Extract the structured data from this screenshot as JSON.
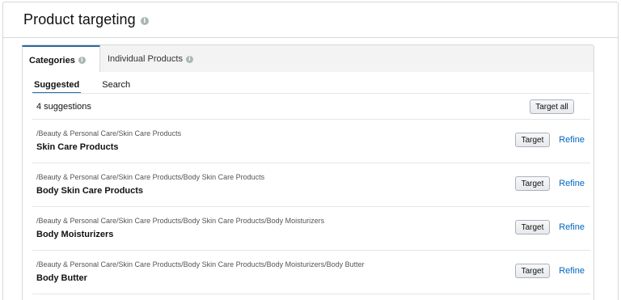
{
  "header": {
    "title": "Product targeting",
    "info_icon": "info-icon"
  },
  "tabs": [
    {
      "label": "Categories",
      "active": true
    },
    {
      "label": "Individual Products",
      "active": false
    }
  ],
  "subtabs": [
    {
      "label": "Suggested",
      "active": true
    },
    {
      "label": "Search",
      "active": false
    }
  ],
  "summary": {
    "count_label": "4 suggestions",
    "target_all_label": "Target all"
  },
  "suggestions": [
    {
      "path": "/Beauty & Personal Care/Skin Care Products",
      "name": "Skin Care Products",
      "target_label": "Target",
      "refine_label": "Refine"
    },
    {
      "path": "/Beauty & Personal Care/Skin Care Products/Body Skin Care Products",
      "name": "Body Skin Care Products",
      "target_label": "Target",
      "refine_label": "Refine"
    },
    {
      "path": "/Beauty & Personal Care/Skin Care Products/Body Skin Care Products/Body Moisturizers",
      "name": "Body Moisturizers",
      "target_label": "Target",
      "refine_label": "Refine"
    },
    {
      "path": "/Beauty & Personal Care/Skin Care Products/Body Skin Care Products/Body Moisturizers/Body Butter",
      "name": "Body Butter",
      "target_label": "Target",
      "refine_label": "Refine"
    }
  ],
  "colors": {
    "accent": "#2c6aa0",
    "link": "#0066c0",
    "border": "#d5d9d9"
  }
}
